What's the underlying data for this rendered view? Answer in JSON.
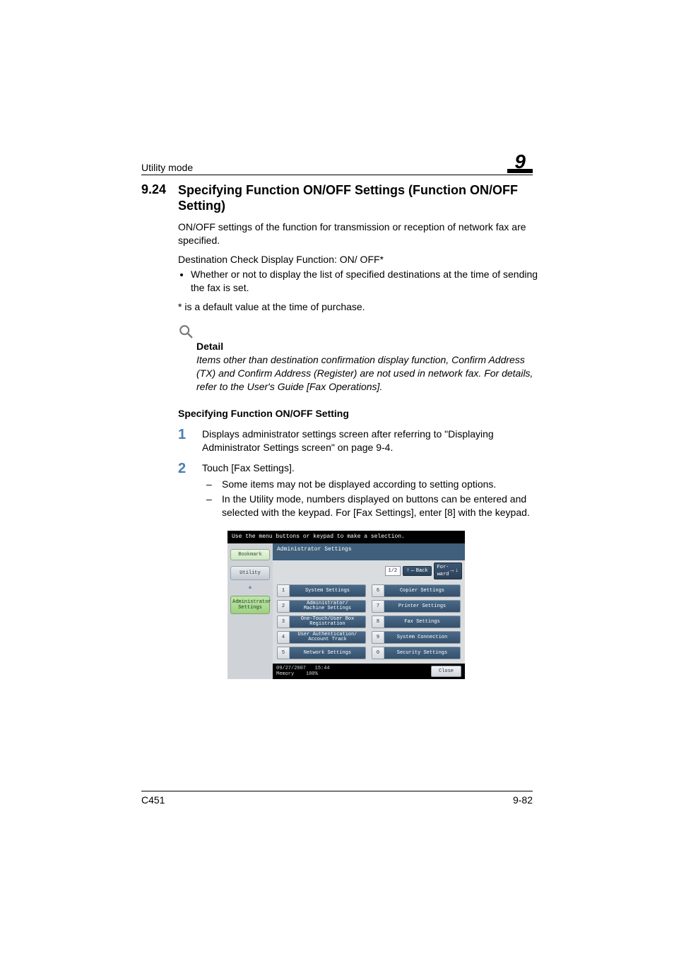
{
  "header": {
    "running_title": "Utility mode",
    "chapter_number": "9"
  },
  "section": {
    "number": "9.24",
    "title": "Specifying Function ON/OFF Settings (Function ON/OFF Setting)"
  },
  "intro_para": "ON/OFF settings of the function for transmission or reception of network fax are specified.",
  "dest_check_line": "Destination Check Display Function: ON/ OFF*",
  "dest_check_bullet": "Whether or not to display the list of specified destinations at the time of sending the fax is set.",
  "default_note": "* is a default value at the time of purchase.",
  "detail": {
    "label": "Detail",
    "text": "Items other than destination confirmation display function, Confirm Address (TX) and Confirm Address (Register) are not used in network fax. For details, refer to the User's Guide [Fax Operations]."
  },
  "subheading": "Specifying Function ON/OFF Setting",
  "steps": [
    {
      "num": "1",
      "text": "Displays administrator settings screen after referring to \"Displaying Administrator Settings screen\" on page 9-4.",
      "sub": []
    },
    {
      "num": "2",
      "text": "Touch [Fax Settings].",
      "sub": [
        "Some items may not be displayed according to setting options.",
        "In the Utility mode, numbers displayed on buttons can be entered and selected with the keypad. For [Fax Settings], enter [8] with the keypad."
      ]
    }
  ],
  "panel": {
    "instruction": "Use the menu buttons or keypad to make a selection.",
    "bookmark": "Bookmark",
    "utility": "Utility",
    "breadcrumb": "Administrator Settings",
    "titlebar": "Administrator Settings",
    "page_indicator": "1/2",
    "back_label": "Back",
    "forward_label": "For-\nward",
    "menu": [
      {
        "n": "1",
        "label": "System Settings"
      },
      {
        "n": "2",
        "label": "Administrator/\nMachine Settings"
      },
      {
        "n": "3",
        "label": "One-Touch/User Box\nRegistration"
      },
      {
        "n": "4",
        "label": "User Authentication/\nAccount Track"
      },
      {
        "n": "5",
        "label": "Network Settings"
      },
      {
        "n": "6",
        "label": "Copier Settings"
      },
      {
        "n": "7",
        "label": "Printer Settings"
      },
      {
        "n": "8",
        "label": "Fax Settings"
      },
      {
        "n": "9",
        "label": "System Connection"
      },
      {
        "n": "0",
        "label": "Security Settings"
      }
    ],
    "status": {
      "date": "09/27/2007",
      "time": "15:44",
      "mem_label": "Memory",
      "mem_value": "100%"
    },
    "close": "Close"
  },
  "footer": {
    "model": "C451",
    "page": "9-82"
  }
}
